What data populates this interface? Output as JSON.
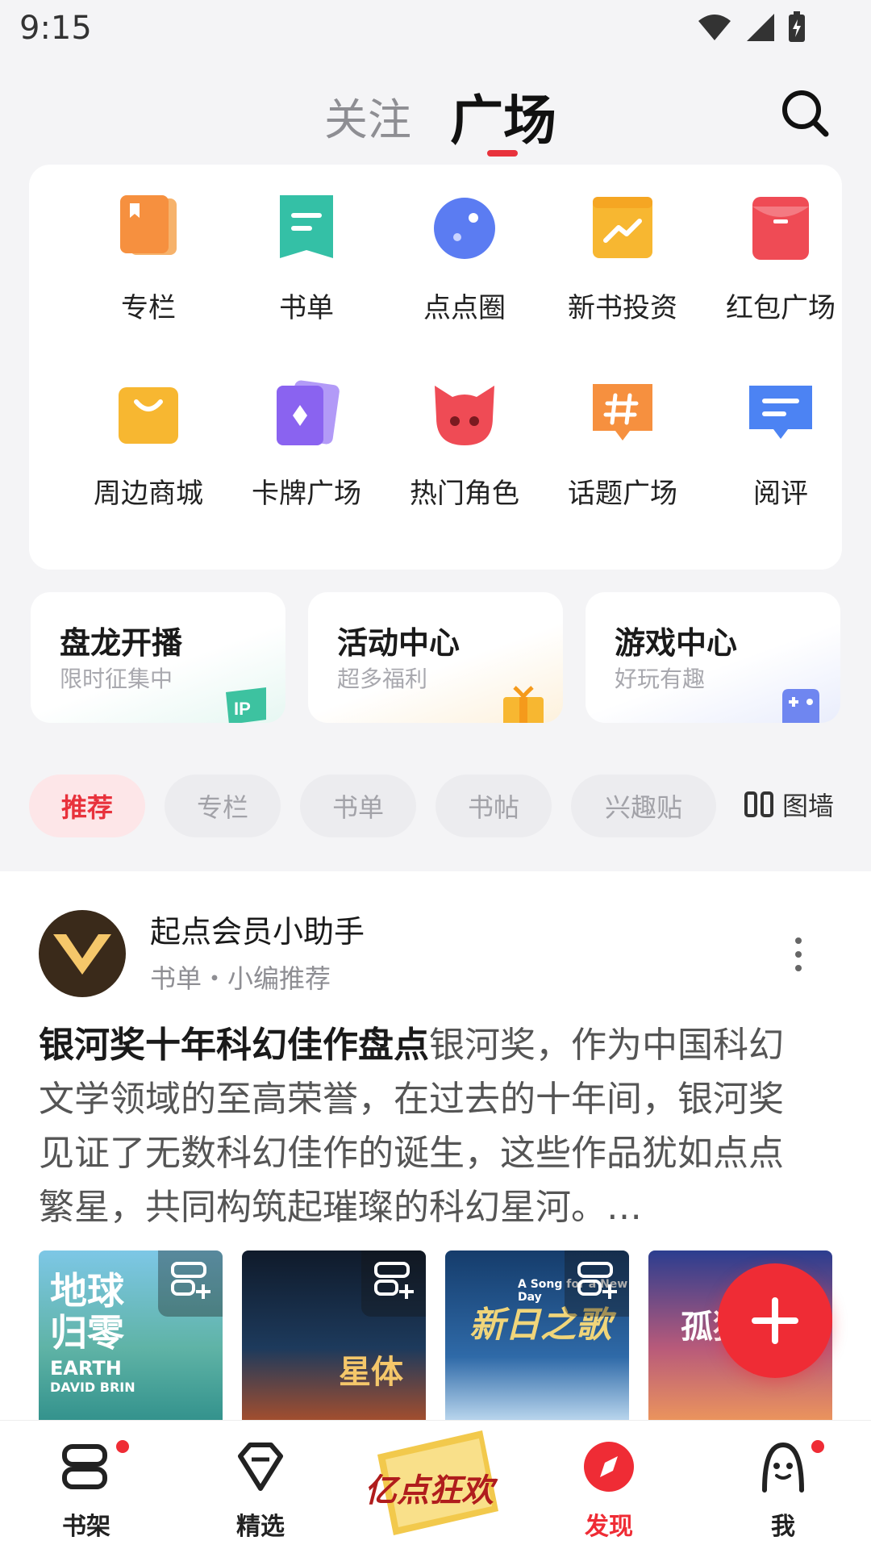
{
  "status_bar": {
    "time": "9:15"
  },
  "top_nav": {
    "tabs": [
      "关注",
      "广场"
    ],
    "active_tab": "广场"
  },
  "features": [
    {
      "label": "专栏",
      "icon": "column-icon",
      "color": "#f6903f"
    },
    {
      "label": "书单",
      "icon": "booklist-icon",
      "color": "#34c0a6"
    },
    {
      "label": "点点圈",
      "icon": "planet-icon",
      "color": "#5b7cf2"
    },
    {
      "label": "新书投资",
      "icon": "trend-folder-icon",
      "color": "#f7b731"
    },
    {
      "label": "红包广场",
      "icon": "red-packet-icon",
      "color": "#ef4b55"
    },
    {
      "label": "周边商城",
      "icon": "shopping-bag-icon",
      "color": "#f7b731"
    },
    {
      "label": "卡牌广场",
      "icon": "cards-icon",
      "color": "#8a63f0"
    },
    {
      "label": "热门角色",
      "icon": "character-icon",
      "color": "#ef4b55"
    },
    {
      "label": "话题广场",
      "icon": "hashtag-icon",
      "color": "#f6903f"
    },
    {
      "label": "阅评",
      "icon": "comment-icon",
      "color": "#4c83f3"
    }
  ],
  "entries": [
    {
      "title": "盘龙开播",
      "subtitle": "限时征集中"
    },
    {
      "title": "活动中心",
      "subtitle": "超多福利"
    },
    {
      "title": "游戏中心",
      "subtitle": "好玩有趣"
    }
  ],
  "filters": {
    "chips": [
      "推荐",
      "专栏",
      "书单",
      "书帖",
      "兴趣贴"
    ],
    "active": "推荐",
    "wall_label": "图墙"
  },
  "post": {
    "author": "起点会员小助手",
    "meta": "书单・小编推荐",
    "title": "银河奖十年科幻佳作盘点",
    "body": "银河奖，作为中国科幻文学领域的至高荣誉，在过去的十年间，银河奖见证了无数科幻佳作的诞生，这些作品犹如点点繁星，共同构筑起璀璨的科幻星河。…",
    "covers": [
      {
        "title_line1": "地球",
        "title_line2": "归零",
        "subtitle": "EARTH",
        "author": "DAVID BRIN"
      },
      {
        "title_line1": "星体",
        "title_line2": "",
        "subtitle": "",
        "author": ""
      },
      {
        "title_line1": "新日之歌",
        "title_line2": "",
        "subtitle": "A Song for a New Day",
        "author": ""
      },
      {
        "title_line1": "孤独",
        "title_line2": "",
        "subtitle": "",
        "author": ""
      }
    ]
  },
  "bottom_nav": {
    "items": [
      {
        "label": "书架",
        "icon": "bookshelf-icon",
        "badge": true
      },
      {
        "label": "精选",
        "icon": "diamond-icon",
        "badge": false
      },
      {
        "label": "发现",
        "icon": "compass-icon",
        "badge": false,
        "active": true
      },
      {
        "label": "我",
        "icon": "profile-icon",
        "badge": true
      }
    ],
    "promo_text": "亿点狂欢"
  },
  "colors": {
    "accent": "#ef2c35",
    "active_chip_bg": "#fde6e8"
  }
}
